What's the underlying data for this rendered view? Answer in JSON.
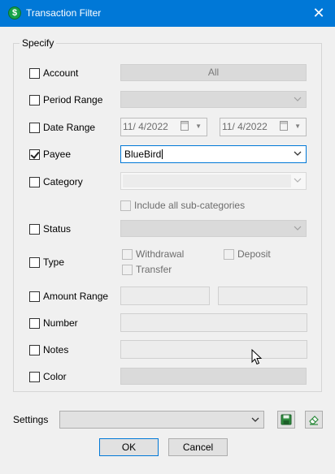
{
  "window": {
    "title": "Transaction Filter",
    "icon": "dollar-icon",
    "icon_glyph": "$",
    "close_glyph": "✕"
  },
  "group": {
    "legend": "Specify"
  },
  "account": {
    "label": "Account",
    "checked": false,
    "value": "All"
  },
  "period_range": {
    "label": "Period Range",
    "checked": false
  },
  "date_range": {
    "label": "Date Range",
    "checked": false,
    "start": "11/ 4/2022",
    "end": "11/ 4/2022"
  },
  "payee": {
    "label": "Payee",
    "checked": true,
    "value": "BlueBird"
  },
  "category": {
    "label": "Category",
    "checked": false,
    "include_sub_label": "Include all sub-categories"
  },
  "status": {
    "label": "Status",
    "checked": false
  },
  "type": {
    "label": "Type",
    "checked": false,
    "withdrawal_label": "Withdrawal",
    "deposit_label": "Deposit",
    "transfer_label": "Transfer"
  },
  "amount_range": {
    "label": "Amount Range",
    "checked": false
  },
  "number": {
    "label": "Number",
    "checked": false
  },
  "notes": {
    "label": "Notes",
    "checked": false
  },
  "color": {
    "label": "Color",
    "checked": false
  },
  "settings": {
    "label": "Settings",
    "value": "",
    "save_icon": "save-icon",
    "clear_icon": "eraser-icon"
  },
  "buttons": {
    "ok": "OK",
    "cancel": "Cancel"
  },
  "colors": {
    "titlebar": "#0078d7",
    "focus_border": "#0078d7",
    "app_icon": "#16a34a"
  }
}
